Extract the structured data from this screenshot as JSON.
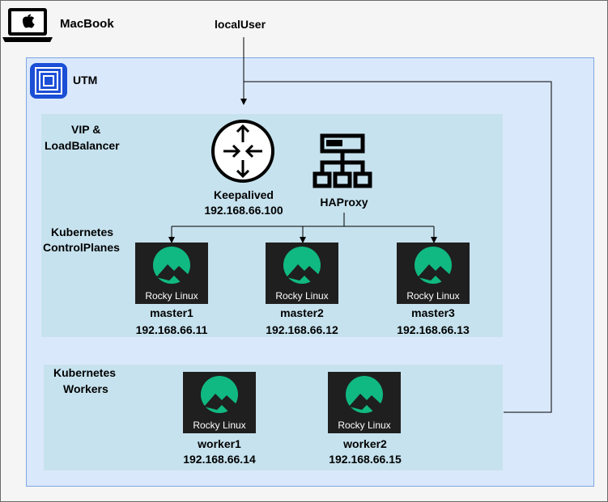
{
  "macbook": {
    "label": "MacBook",
    "icon": "laptop-apple-icon"
  },
  "local_user": {
    "label": "localUser"
  },
  "utm": {
    "label": "UTM",
    "icon": "utm-app-icon"
  },
  "vip_group": {
    "title_line1": "VIP &",
    "title_line2": "LoadBalancer"
  },
  "keepalived": {
    "icon": "router-icon",
    "name": "Keepalived",
    "ip": "192.168.66.100"
  },
  "haproxy": {
    "icon": "network-hierarchy-icon",
    "name": "HAProxy"
  },
  "control_planes": {
    "title_line1": "Kubernetes",
    "title_line2": "ControlPlanes",
    "nodes": [
      {
        "name": "master1",
        "ip": "192.168.66.11",
        "logo_text": "Rocky Linux"
      },
      {
        "name": "master2",
        "ip": "192.168.66.12",
        "logo_text": "Rocky Linux"
      },
      {
        "name": "master3",
        "ip": "192.168.66.13",
        "logo_text": "Rocky Linux"
      }
    ]
  },
  "workers": {
    "title_line1": "Kubernetes",
    "title_line2": "Workers",
    "nodes": [
      {
        "name": "worker1",
        "ip": "192.168.66.14",
        "logo_text": "Rocky Linux"
      },
      {
        "name": "worker2",
        "ip": "192.168.66.15",
        "logo_text": "Rocky Linux"
      }
    ]
  },
  "colors": {
    "frame_bg": "#f5f5f5",
    "utm_bg": "#dae8fc",
    "utm_border": "#7ea6e0",
    "group_bg": "#c6e2ee",
    "rocky_green": "#10b981",
    "rocky_bg": "#1f1f1f"
  }
}
